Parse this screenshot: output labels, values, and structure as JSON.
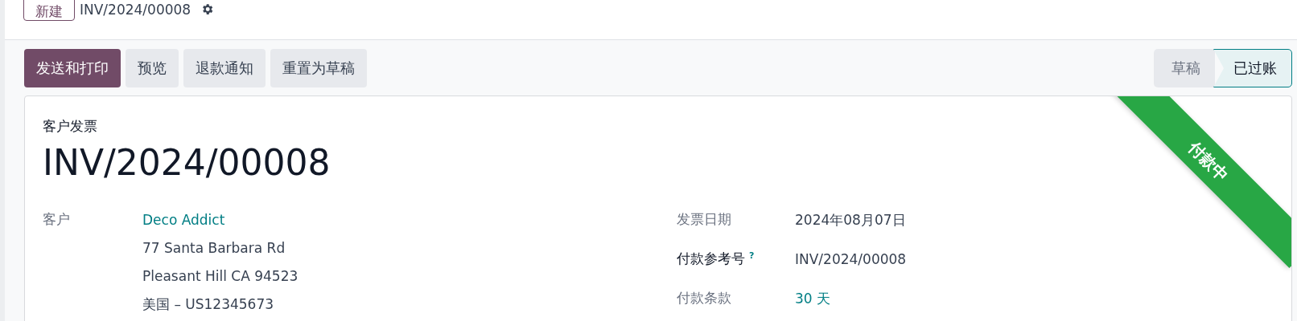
{
  "header": {
    "new_button": "新建",
    "record_title": "INV/2024/00008"
  },
  "actions": [
    {
      "label": "发送和打印",
      "primary": true
    },
    {
      "label": "预览",
      "primary": false
    },
    {
      "label": "退款通知",
      "primary": false
    },
    {
      "label": "重置为草稿",
      "primary": false
    }
  ],
  "status_steps": [
    {
      "label": "草稿",
      "selected": false
    },
    {
      "label": "已过账",
      "selected": true
    }
  ],
  "form": {
    "doc_type": "客户发票",
    "number": "INV/2024/00008",
    "ribbon": "付款中",
    "customer": {
      "label": "客户",
      "name": "Deco Addict",
      "address": [
        "77 Santa Barbara Rd",
        "Pleasant Hill CA 94523",
        "美国 – US12345673"
      ]
    },
    "fields": [
      {
        "label": "发票日期",
        "value": "2024年08月07日",
        "kind": "plain",
        "strong": false
      },
      {
        "label": "付款参考号",
        "value": "INV/2024/00008",
        "kind": "plain",
        "help": "?",
        "strong": true
      },
      {
        "label": "付款条款",
        "value": "30 天",
        "kind": "link",
        "strong": false
      }
    ]
  }
}
